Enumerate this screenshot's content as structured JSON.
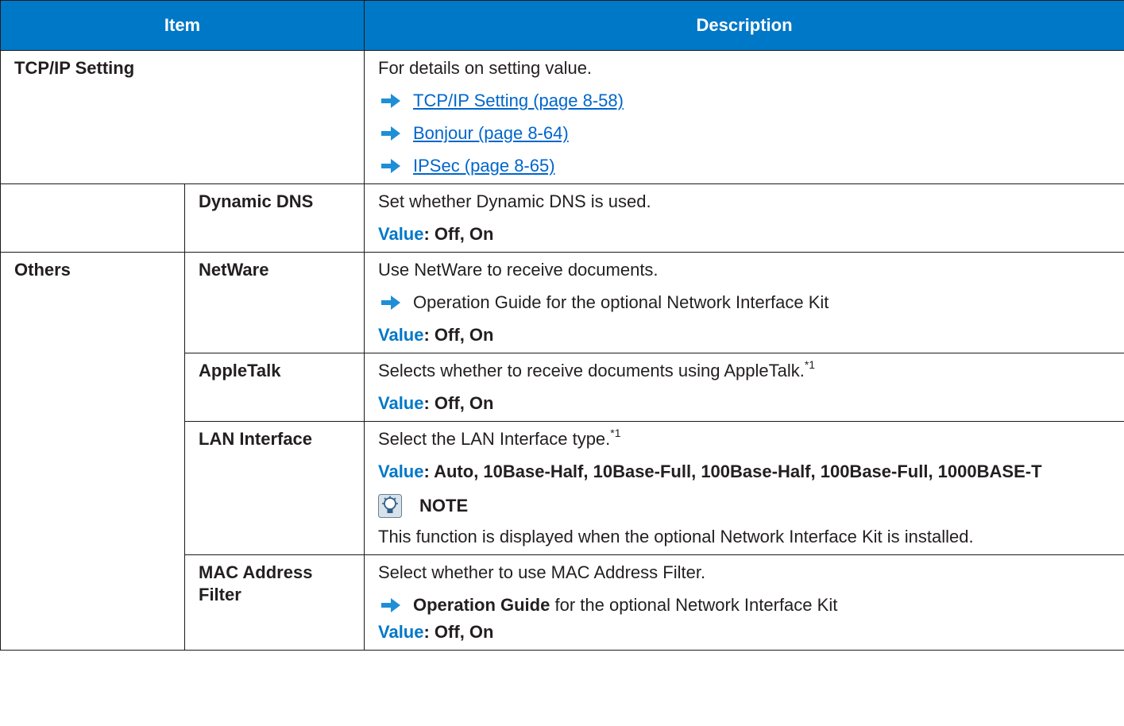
{
  "header": {
    "item": "Item",
    "description": "Description"
  },
  "tcpip": {
    "label": "TCP/IP Setting",
    "intro": "For details on setting value.",
    "links": [
      "TCP/IP Setting (page 8-58)",
      "Bonjour (page 8-64)",
      "IPSec (page 8-65)"
    ]
  },
  "dynamic_dns": {
    "label": "Dynamic DNS",
    "desc": "Set whether Dynamic DNS is used.",
    "value_key": "Value",
    "value_text": ": Off, On"
  },
  "others": {
    "label": "Others"
  },
  "netware": {
    "label": "NetWare",
    "desc": "Use NetWare to receive documents.",
    "ref": "Operation Guide for the optional Network Interface Kit",
    "value_key": "Value",
    "value_text": ": Off, On"
  },
  "appletalk": {
    "label": "AppleTalk",
    "desc": "Selects whether to receive documents using AppleTalk.",
    "footnote": "*1",
    "value_key": "Value",
    "value_text": ": Off, On"
  },
  "lan_interface": {
    "label": "LAN Interface",
    "desc": "Select the LAN Interface type.",
    "footnote": "*1",
    "value_key": "Value",
    "value_text": ": Auto, 10Base-Half, 10Base-Full, 100Base-Half, 100Base-Full, 1000BASE-T",
    "note_title": "NOTE",
    "note_text": "This function is displayed when the optional Network Interface Kit is installed."
  },
  "mac_filter": {
    "label": "MAC Address Filter",
    "desc": "Select whether to use MAC Address Filter.",
    "ref_bold": "Operation Guide",
    "ref_rest": " for the optional Network Interface Kit",
    "value_key": "Value",
    "value_text": ": Off, On"
  },
  "colors": {
    "header_bg": "#0078c8",
    "link": "#0066cc",
    "value_label": "#0078c8",
    "arrow": "#1e8fd6"
  },
  "icons": {
    "reference": "right-arrow-icon",
    "note": "lightbulb-note-icon"
  }
}
